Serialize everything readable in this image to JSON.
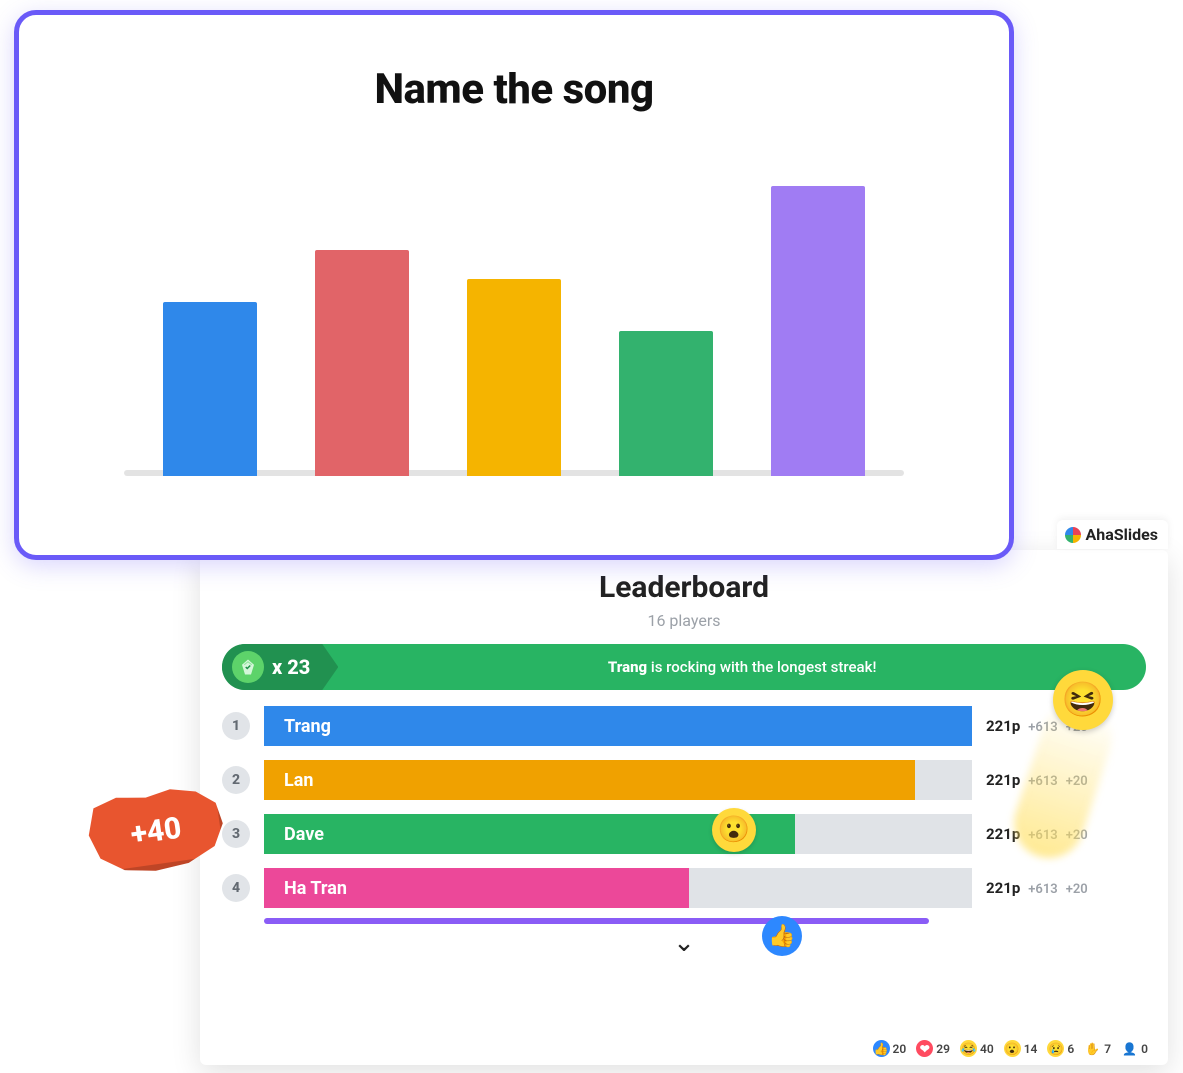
{
  "chart_data": {
    "type": "bar",
    "title": "Name the song",
    "categories": [
      "",
      "",
      "",
      "",
      ""
    ],
    "values": [
      60,
      78,
      68,
      50,
      100
    ],
    "colors": [
      "#2f88ea",
      "#e16468",
      "#f5b400",
      "#33b26e",
      "#a07cf3"
    ],
    "ylim": [
      0,
      100
    ],
    "xlabel": "",
    "ylabel": ""
  },
  "brand": {
    "name": "AhaSlides"
  },
  "leaderboard": {
    "title": "Leaderboard",
    "players_label": "16 players",
    "streak": {
      "multiplier": "x 23",
      "name": "Trang",
      "rest": " is rocking with the longest streak!"
    },
    "rows": [
      {
        "rank": "1",
        "name": "Trang",
        "fill_pct": 100,
        "color": "#2f88ea",
        "points": "221p",
        "delta1": "+613",
        "delta2": "+20"
      },
      {
        "rank": "2",
        "name": "Lan",
        "fill_pct": 92,
        "color": "#f0a100",
        "points": "221p",
        "delta1": "+613",
        "delta2": "+20"
      },
      {
        "rank": "3",
        "name": "Dave",
        "fill_pct": 75,
        "color": "#28b463",
        "points": "221p",
        "delta1": "+613",
        "delta2": "+20"
      },
      {
        "rank": "4",
        "name": "Ha Tran",
        "fill_pct": 60,
        "color": "#ec4899",
        "points": "221p",
        "delta1": "+613",
        "delta2": "+20"
      }
    ],
    "reactions": [
      {
        "kind": "like",
        "count": "20"
      },
      {
        "kind": "heart",
        "count": "29"
      },
      {
        "kind": "laugh",
        "count": "40"
      },
      {
        "kind": "wow",
        "count": "14"
      },
      {
        "kind": "sad",
        "count": "6"
      },
      {
        "kind": "hand",
        "count": "7"
      },
      {
        "kind": "user",
        "count": "0"
      }
    ]
  },
  "coupon": {
    "label": "+40"
  }
}
